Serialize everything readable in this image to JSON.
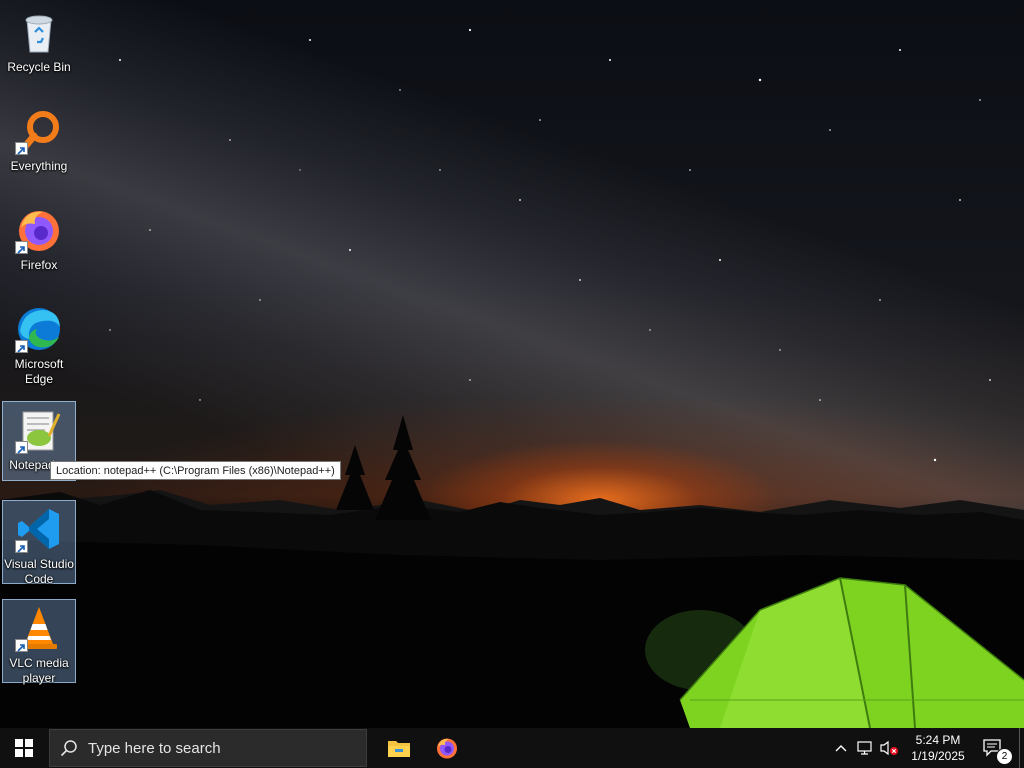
{
  "desktop": {
    "icons": [
      {
        "label": "Recycle Bin",
        "icon": "recycle-bin-icon",
        "shortcut": false,
        "selected": false
      },
      {
        "label": "Everything",
        "icon": "everything-search-icon",
        "shortcut": true,
        "selected": false
      },
      {
        "label": "Firefox",
        "icon": "firefox-icon",
        "shortcut": true,
        "selected": false
      },
      {
        "label": "Microsoft Edge",
        "icon": "edge-icon",
        "shortcut": true,
        "selected": false
      },
      {
        "label": "Notepad++",
        "icon": "notepadpp-icon",
        "shortcut": true,
        "selected": true
      },
      {
        "label": "Visual Studio Code",
        "icon": "vscode-icon",
        "shortcut": true,
        "selected": true
      },
      {
        "label": "VLC media player",
        "icon": "vlc-icon",
        "shortcut": true,
        "selected": true
      }
    ],
    "tooltip": "Location: notepad++ (C:\\Program Files (x86)\\Notepad++)"
  },
  "taskbar": {
    "search_placeholder": "Type here to search",
    "pinned": [
      {
        "name": "File Explorer",
        "icon": "file-explorer-icon"
      },
      {
        "name": "Firefox",
        "icon": "firefox-icon"
      }
    ],
    "tray": {
      "time": "5:24 PM",
      "date": "1/19/2025",
      "notification_count": "2"
    }
  },
  "colors": {
    "taskbar": "#101010",
    "search_box": "#2b2b2b",
    "selection": "#82aad7",
    "tent": "#7ed321"
  }
}
